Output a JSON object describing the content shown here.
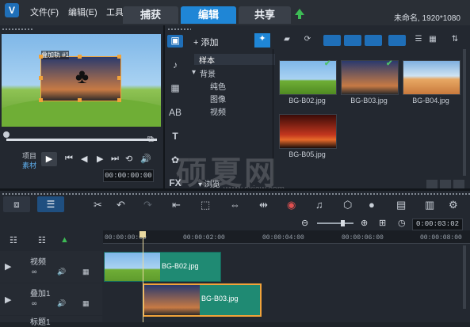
{
  "app": {
    "menus": [
      "文件(F)",
      "编辑(E)",
      "工具"
    ],
    "mode_tabs": [
      "捕获",
      "编辑",
      "共享"
    ],
    "active_mode": "编辑",
    "project_info": "未命名, 1920*1080"
  },
  "preview": {
    "overlay_label": "叠加轨 #1",
    "project_label": "项目",
    "material_label": "素材",
    "timecode": "00:00:00:00"
  },
  "library": {
    "add_label": "添加",
    "tree": [
      {
        "label": "样本",
        "selected": true
      },
      {
        "label": "背景",
        "selected": false,
        "expanded": true
      },
      {
        "label": "纯色",
        "selected": false
      },
      {
        "label": "图像",
        "selected": false
      },
      {
        "label": "视频",
        "selected": false
      }
    ],
    "browse_label": "浏览",
    "thumbnails": [
      {
        "name": "BG-B02.jpg",
        "checked": true
      },
      {
        "name": "BG-B03.jpg",
        "checked": true
      },
      {
        "name": "BG-B04.jpg",
        "checked": false
      },
      {
        "name": "BG-B05.jpg",
        "checked": false
      }
    ],
    "side_icons": [
      "media-icon",
      "audio-icon",
      "title-icon",
      "transition-icon",
      "text-icon",
      "filter-icon",
      "fx-icon"
    ],
    "fx_label": "FX",
    "text_icon_label": "T",
    "ab_label": "AB"
  },
  "watermark": {
    "main": "硕夏网",
    "url": "www.sxjaw.com"
  },
  "timeline": {
    "timecode": "0:00:03:02",
    "ruler_ticks": [
      "00:00:00:00",
      "00:00:02:00",
      "00:00:04:00",
      "00:00:06:00",
      "00:00:08:00"
    ],
    "tracks": [
      {
        "name": "视频",
        "clip": "BG-B02.jpg"
      },
      {
        "name": "叠加1",
        "clip": "BG-B03.jpg"
      },
      {
        "name": "标题1",
        "clip": ""
      }
    ]
  }
}
